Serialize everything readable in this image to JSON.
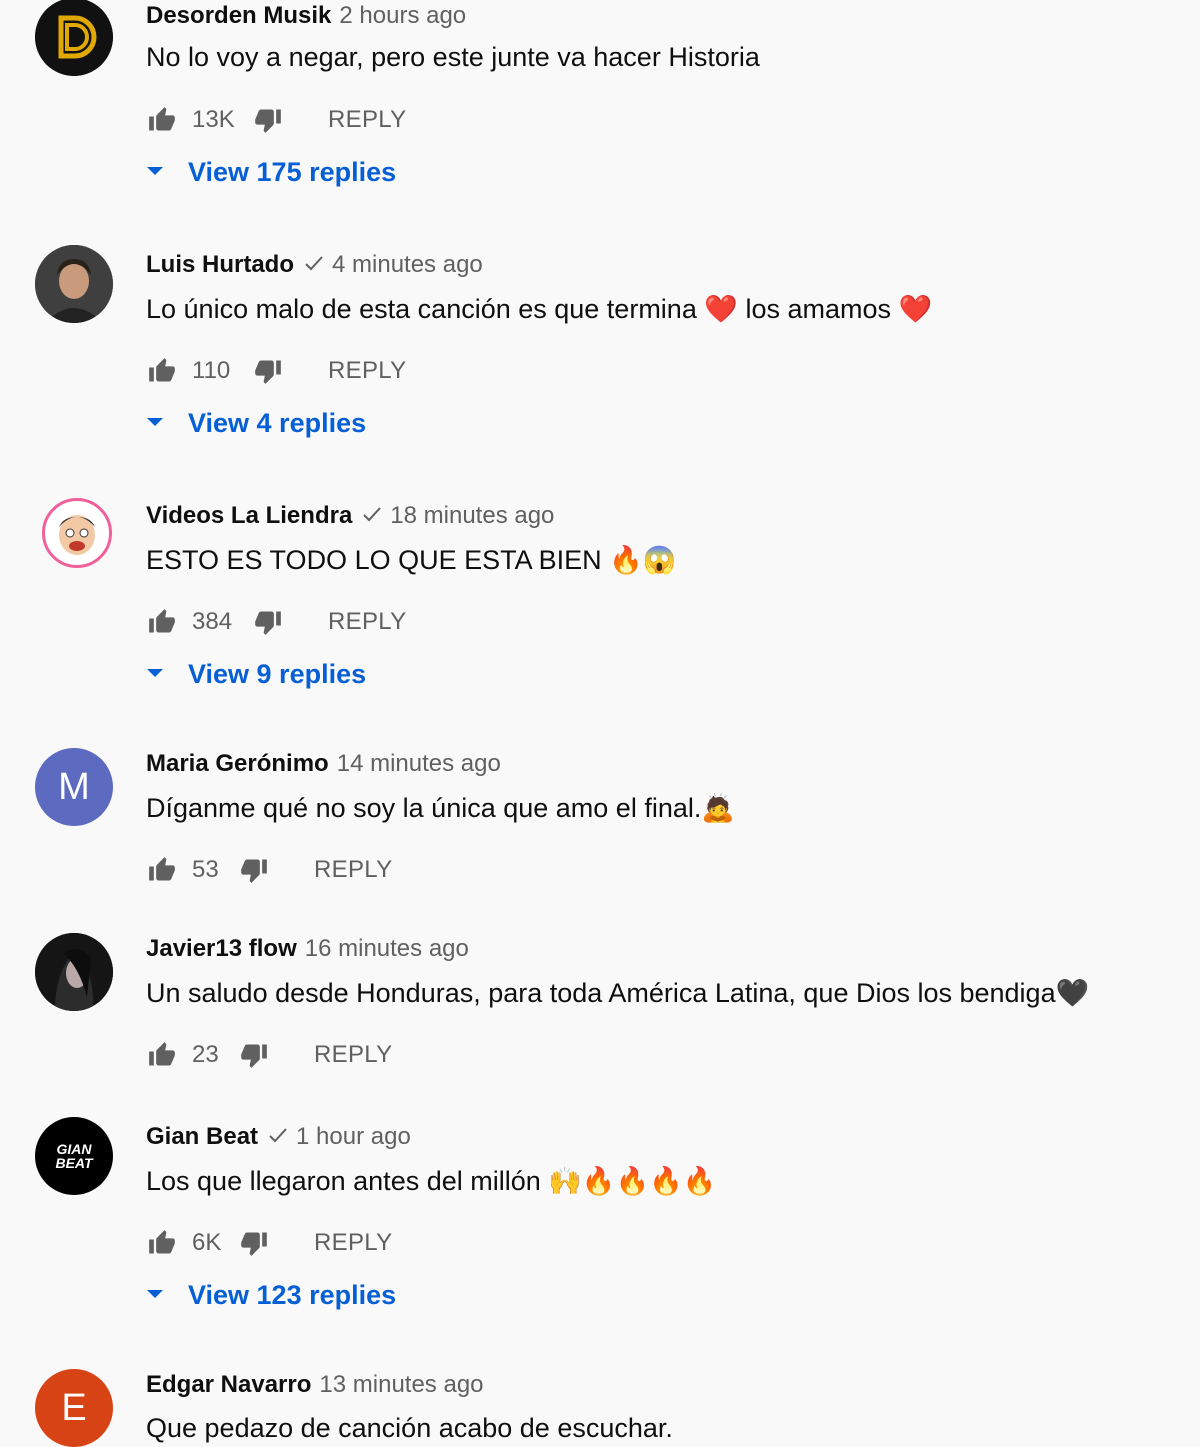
{
  "comments": [
    {
      "author": "Desorden Musik",
      "verified": false,
      "time": "2 hours ago",
      "text": "No lo voy a negar,  pero este junte va hacer Historia",
      "likes": "13K",
      "reply_label": "REPLY",
      "view_replies": "View 175 replies",
      "avatar": {
        "type": "logo",
        "letter": "D",
        "bg": "#111111",
        "fg": "#e0a800"
      }
    },
    {
      "author": "Luis Hurtado",
      "verified": true,
      "time": "4 minutes ago",
      "text": "Lo único malo de esta canción es que termina ❤️ los amamos ❤️",
      "likes": "110",
      "reply_label": "REPLY",
      "view_replies": "View 4 replies",
      "avatar": {
        "type": "photo",
        "bg": "#4a4a4a"
      }
    },
    {
      "author": "Videos La Liendra",
      "verified": true,
      "time": "18 minutes ago",
      "text": "ESTO ES TODO LO QUE ESTA BIEN 🔥😱",
      "likes": "384",
      "reply_label": "REPLY",
      "view_replies": "View 9 replies",
      "avatar": {
        "type": "cartoon",
        "bg": "#ffffff"
      }
    },
    {
      "author": "Maria Gerónimo",
      "verified": false,
      "time": "14 minutes ago",
      "text": "Díganme qué no soy la única que amo el final.🙇",
      "likes": "53",
      "reply_label": "REPLY",
      "avatar": {
        "type": "letter",
        "letter": "M",
        "bg": "#5c6bc0",
        "fg": "#ffffff"
      }
    },
    {
      "author": "Javier13 flow",
      "verified": false,
      "time": "16 minutes ago",
      "text": "Un saludo desde Honduras, para toda América Latina, que Dios los bendiga🖤",
      "likes": "23",
      "reply_label": "REPLY",
      "avatar": {
        "type": "photo",
        "bg": "#1c1c1c"
      }
    },
    {
      "author": "Gian Beat",
      "verified": true,
      "time": "1 hour ago",
      "text": "Los que llegaron antes del millón 🙌🔥🔥🔥🔥",
      "likes": "6K",
      "reply_label": "REPLY",
      "view_replies": "View 123 replies",
      "avatar": {
        "type": "logo-text",
        "letter": "GIAN BEAT",
        "bg": "#000000",
        "fg": "#ffffff"
      }
    },
    {
      "author": "Edgar Navarro",
      "verified": false,
      "time": "13 minutes ago",
      "text": "Que pedazo de canción acabo de escuchar.",
      "avatar": {
        "type": "letter",
        "letter": "E",
        "bg": "#d84315",
        "fg": "#ffffff"
      }
    }
  ],
  "icons": {
    "like": "thumbs-up-icon",
    "dislike": "thumbs-down-icon",
    "caret": "caret-down-icon",
    "verified": "check-icon"
  },
  "colors": {
    "link": "#065fd4",
    "muted": "#606060",
    "background": "#f9f9f9"
  }
}
